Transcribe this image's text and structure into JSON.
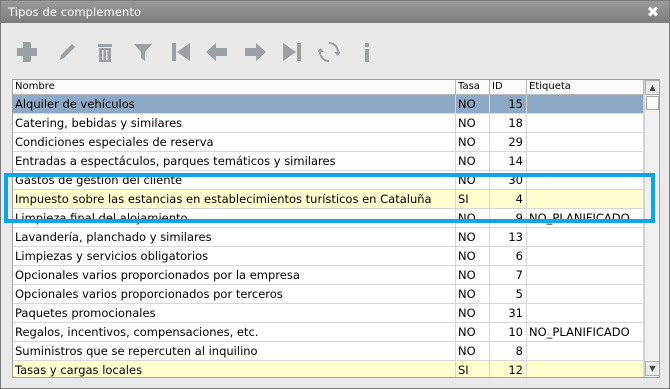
{
  "window": {
    "title": "Tipos de complemento",
    "close_glyph": "✖"
  },
  "toolbar": {
    "buttons": [
      {
        "name": "add-icon"
      },
      {
        "name": "edit-icon"
      },
      {
        "name": "delete-icon"
      },
      {
        "name": "filter-icon"
      },
      {
        "name": "first-record-icon"
      },
      {
        "name": "previous-record-icon"
      },
      {
        "name": "next-record-icon"
      },
      {
        "name": "last-record-icon"
      },
      {
        "name": "refresh-icon"
      },
      {
        "name": "info-icon"
      }
    ],
    "icon_color": "#9aa0a6"
  },
  "grid": {
    "columns": {
      "nombre": "Nombre",
      "tasa": "Tasa",
      "id": "ID",
      "etiqueta": "Etiqueta"
    },
    "rows": [
      {
        "nombre": "Alquiler de vehículos",
        "tasa": "NO",
        "id": "15",
        "etiqueta": "",
        "state": "selected"
      },
      {
        "nombre": "Catering, bebidas y similares",
        "tasa": "NO",
        "id": "18",
        "etiqueta": "",
        "state": ""
      },
      {
        "nombre": "Condiciones especiales de reserva",
        "tasa": "NO",
        "id": "29",
        "etiqueta": "",
        "state": ""
      },
      {
        "nombre": "Entradas a espectáculos, parques temáticos y similares",
        "tasa": "NO",
        "id": "14",
        "etiqueta": "",
        "state": ""
      },
      {
        "nombre": "Gastos de gestión del cliente",
        "tasa": "NO",
        "id": "30",
        "etiqueta": "",
        "state": ""
      },
      {
        "nombre": "Impuesto sobre las estancias en establecimientos turísticos en Cataluña",
        "tasa": "SI",
        "id": "4",
        "etiqueta": "",
        "state": "yellow"
      },
      {
        "nombre": "Limpieza final del alojamiento",
        "tasa": "NO",
        "id": "9",
        "etiqueta": "NO_PLANIFICADO",
        "state": ""
      },
      {
        "nombre": "Lavandería, planchado y similares",
        "tasa": "NO",
        "id": "13",
        "etiqueta": "",
        "state": ""
      },
      {
        "nombre": "Limpiezas y servicios obligatorios",
        "tasa": "NO",
        "id": "6",
        "etiqueta": "",
        "state": ""
      },
      {
        "nombre": "Opcionales varios proporcionados por la empresa",
        "tasa": "NO",
        "id": "7",
        "etiqueta": "",
        "state": ""
      },
      {
        "nombre": "Opcionales varios proporcionados por terceros",
        "tasa": "NO",
        "id": "5",
        "etiqueta": "",
        "state": ""
      },
      {
        "nombre": "Paquetes promocionales",
        "tasa": "NO",
        "id": "31",
        "etiqueta": "",
        "state": ""
      },
      {
        "nombre": "Regalos, incentivos, compensaciones, etc.",
        "tasa": "NO",
        "id": "10",
        "etiqueta": "NO_PLANIFICADO",
        "state": ""
      },
      {
        "nombre": "Suministros que se repercuten al inquilino",
        "tasa": "NO",
        "id": "8",
        "etiqueta": "",
        "state": ""
      },
      {
        "nombre": "Tasas y cargas locales",
        "tasa": "SI",
        "id": "12",
        "etiqueta": "",
        "state": "yellow"
      }
    ],
    "selected_row_color": "#8ea9c6",
    "tax_row_color": "#ffffcf"
  },
  "annotation": {
    "highlight_color": "#0ea5e9"
  }
}
